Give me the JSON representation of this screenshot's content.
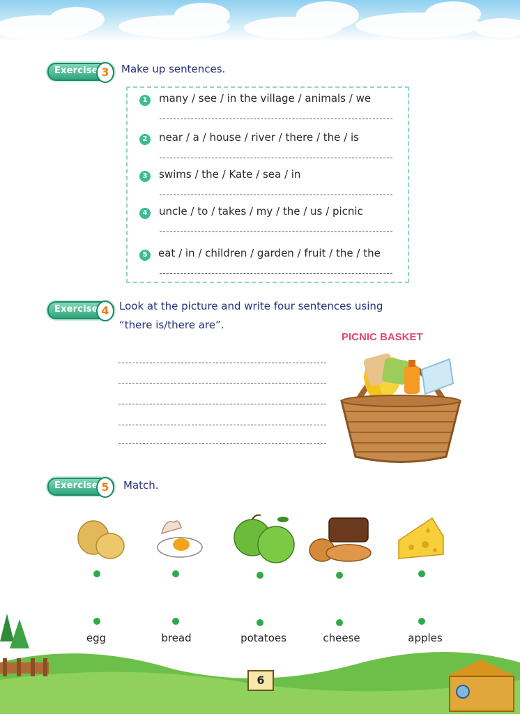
{
  "exercise3": {
    "badge": "Exercise",
    "number": "3",
    "instruction": "Make up sentences.",
    "items": [
      {
        "n": "1",
        "text": "many / see / in the village / animals / we"
      },
      {
        "n": "2",
        "text": "near / a / house / river / there / the / is"
      },
      {
        "n": "3",
        "text": "swims / the / Kate / sea / in"
      },
      {
        "n": "4",
        "text": "uncle / to / takes / my / the / us / picnic"
      },
      {
        "n": "5",
        "text": "eat / in / children / garden / fruit  / the / the"
      }
    ]
  },
  "exercise4": {
    "badge": "Exercise",
    "number": "4",
    "instruction_line1": "Look at the picture and write four sentences using",
    "instruction_line2": "“there is/there are”.",
    "basket_label": "PICNIC BASKET"
  },
  "exercise5": {
    "badge": "Exercise",
    "number": "5",
    "instruction": "Match.",
    "pictures": [
      "potatoes-image",
      "egg-image",
      "apples-image",
      "bread-image",
      "cheese-image"
    ],
    "words": [
      "egg",
      "bread",
      "potatoes",
      "cheese",
      "apples"
    ]
  },
  "page_number": "6",
  "colors": {
    "accent": "#3bbd8e",
    "instruction": "#27307a",
    "badge_number": "#f07d1a",
    "dot": "#2faa4a"
  }
}
